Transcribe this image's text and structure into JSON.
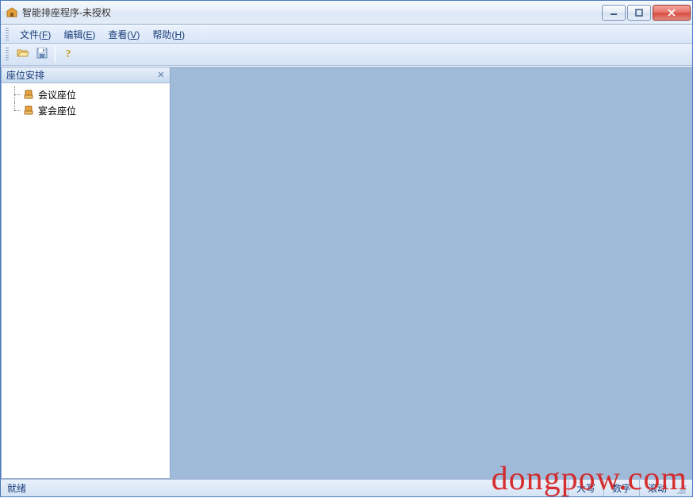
{
  "title": "智能排座程序-未授权",
  "menu": {
    "file": {
      "label": "文件",
      "accel": "F"
    },
    "edit": {
      "label": "编辑",
      "accel": "E"
    },
    "view": {
      "label": "查看",
      "accel": "V"
    },
    "help": {
      "label": "帮助",
      "accel": "H"
    }
  },
  "panel": {
    "title": "座位安排",
    "items": [
      {
        "label": "会议座位"
      },
      {
        "label": "宴会座位"
      }
    ]
  },
  "status": {
    "ready": "就绪",
    "caps": "大写",
    "num": "数字",
    "scroll": "滚动"
  },
  "watermark": "dongpow.com"
}
